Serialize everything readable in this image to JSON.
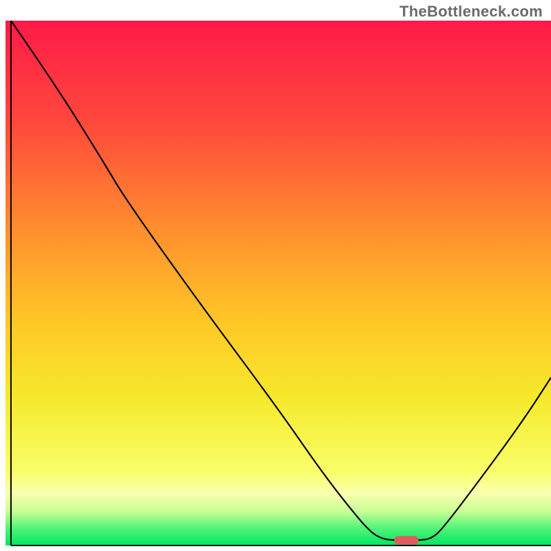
{
  "watermark": "TheBottleneck.com",
  "chart_data": {
    "type": "line",
    "title": "",
    "xlabel": "",
    "ylabel": "",
    "xlim": [
      0,
      100
    ],
    "ylim": [
      0,
      100
    ],
    "gradient_stops": [
      {
        "offset": 0.0,
        "color": "#ff1a48"
      },
      {
        "offset": 0.2,
        "color": "#ff4a3c"
      },
      {
        "offset": 0.4,
        "color": "#ff8f2e"
      },
      {
        "offset": 0.58,
        "color": "#ffc926"
      },
      {
        "offset": 0.72,
        "color": "#f6e92c"
      },
      {
        "offset": 0.86,
        "color": "#f9ff6a"
      },
      {
        "offset": 0.9,
        "color": "#faffb0"
      },
      {
        "offset": 0.935,
        "color": "#c9ff96"
      },
      {
        "offset": 0.965,
        "color": "#58f57a"
      },
      {
        "offset": 1.0,
        "color": "#00e562"
      }
    ],
    "curve": [
      {
        "x": 1.0,
        "y": 100.0
      },
      {
        "x": 9.0,
        "y": 88.0
      },
      {
        "x": 18.0,
        "y": 73.0
      },
      {
        "x": 22.0,
        "y": 66.0
      },
      {
        "x": 35.0,
        "y": 47.0
      },
      {
        "x": 50.0,
        "y": 26.0
      },
      {
        "x": 58.0,
        "y": 14.0
      },
      {
        "x": 64.0,
        "y": 6.0
      },
      {
        "x": 67.0,
        "y": 2.5
      },
      {
        "x": 69.0,
        "y": 1.3
      },
      {
        "x": 71.0,
        "y": 1.0
      },
      {
        "x": 76.0,
        "y": 1.0
      },
      {
        "x": 78.0,
        "y": 1.3
      },
      {
        "x": 80.0,
        "y": 3.0
      },
      {
        "x": 88.0,
        "y": 14.0
      },
      {
        "x": 95.0,
        "y": 24.0
      },
      {
        "x": 100.0,
        "y": 32.0
      }
    ],
    "marker": {
      "x": 73.5,
      "y": 1.0,
      "width": 4.5,
      "height": 1.6,
      "color": "#e05a60"
    },
    "axes": {
      "left": {
        "x0": 1,
        "y0": 0,
        "x1": 1,
        "y1": 100,
        "width": 2
      },
      "bottom": {
        "x0": 1,
        "y0": 0,
        "x1": 100,
        "y1": 0,
        "width": 2
      }
    }
  }
}
